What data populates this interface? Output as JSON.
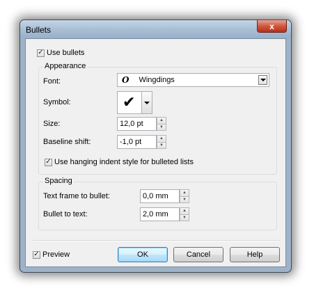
{
  "window": {
    "title": "Bullets",
    "close_glyph": "x"
  },
  "use_bullets": {
    "label": "Use bullets",
    "checked": true
  },
  "appearance": {
    "title": "Appearance",
    "font_label": "Font:",
    "font_icon_glyph": "O",
    "font_value": "Wingdings",
    "symbol_label": "Symbol:",
    "symbol_value": "✔",
    "size_label": "Size:",
    "size_value": "12,0 pt",
    "baseline_label": "Baseline shift:",
    "baseline_value": "-1,0 pt",
    "hanging_label": "Use hanging indent style for bulleted lists",
    "hanging_checked": true
  },
  "spacing": {
    "title": "Spacing",
    "frame_label": "Text frame to bullet:",
    "frame_value": "0,0 mm",
    "bullet_label": "Bullet to text:",
    "bullet_value": "2,0 mm"
  },
  "footer": {
    "preview_label": "Preview",
    "preview_checked": true,
    "ok_label": "OK",
    "cancel_label": "Cancel",
    "help_label": "Help"
  },
  "check_glyph": "✓"
}
